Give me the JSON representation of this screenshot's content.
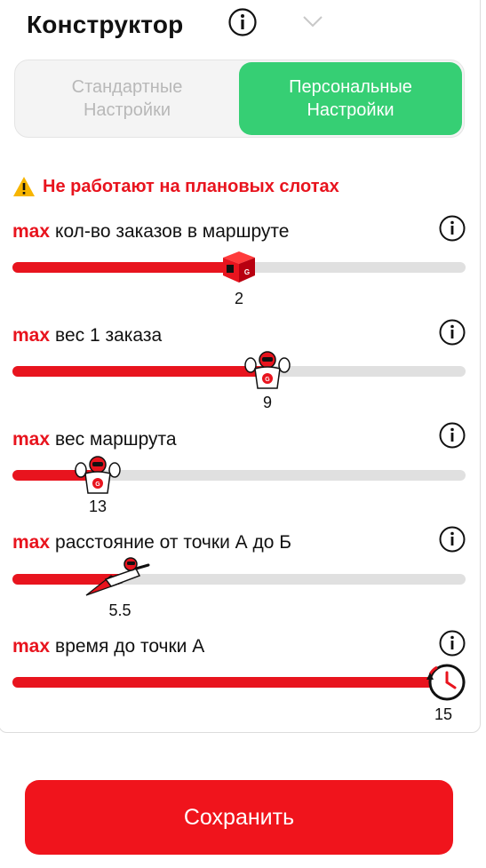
{
  "header": {
    "title": "Конструктор"
  },
  "segment": {
    "standard": "Стандартные Настройки",
    "personal": "Персональные Настройки",
    "active": "personal"
  },
  "warning": {
    "text": "Не работают на плановых слотах"
  },
  "sliders": [
    {
      "max": "max",
      "label": "кол-во заказов в маршруте",
      "value": "2",
      "fraction": 0.5,
      "icon": "box-icon"
    },
    {
      "max": "max",
      "label": "вес 1 заказа",
      "value": "9",
      "fraction": 0.56,
      "icon": "strongman-icon"
    },
    {
      "max": "max",
      "label": "вес маршрута",
      "value": "13",
      "fraction": 0.18,
      "icon": "strongman-icon"
    },
    {
      "max": "max",
      "label": "расстояние от точки А до Б",
      "value": "5.5",
      "fraction": 0.26,
      "icon": "flying-hero-icon"
    },
    {
      "max": "max",
      "label": "время до точки А",
      "value": "15",
      "fraction": 0.97,
      "icon": "stopwatch-icon"
    }
  ],
  "save_button": {
    "label": "Сохранить"
  },
  "colors": {
    "accent": "#e8141e",
    "active_tab": "#36cf74",
    "track": "#e0e0e0"
  }
}
